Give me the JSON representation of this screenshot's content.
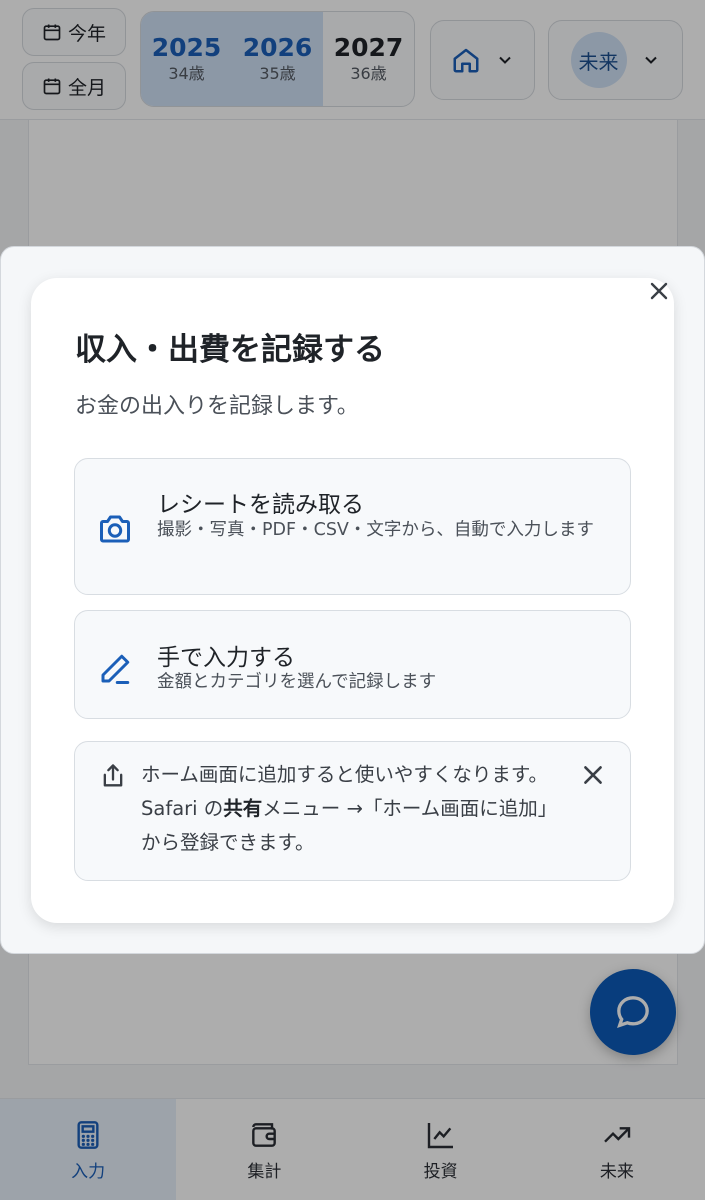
{
  "header": {
    "this_year_label": "今年",
    "full_month_label": "全月",
    "years": [
      {
        "year": "2025",
        "age": "34歳",
        "selected": true
      },
      {
        "year": "2026",
        "age": "35歳",
        "selected": true
      },
      {
        "year": "2027",
        "age": "36歳",
        "selected": false
      }
    ],
    "home_icon": "home-icon",
    "future_avatar_label": "未来"
  },
  "dialog": {
    "title": "収入・出費を記録する",
    "subtitle": "お金の出入りを記録します。",
    "options": [
      {
        "icon": "camera-icon",
        "title": "レシートを読み取る",
        "description": "撮影・写真・PDF・CSV・文字から、自動で入力します"
      },
      {
        "icon": "pencil-icon",
        "title": "手で入力する",
        "description": "金額とカテゴリを選んで記録します"
      }
    ],
    "tip": {
      "icon": "share-icon",
      "text_before": "ホーム画面に追加すると使いやすくなります。Safari の",
      "text_bold": "共有",
      "text_after": "メニュー →「ホーム画面に追加」から登録できます。"
    }
  },
  "bottom_nav": [
    {
      "label": "入力",
      "icon": "calculator-icon",
      "active": true
    },
    {
      "label": "集計",
      "icon": "wallet-icon",
      "active": false
    },
    {
      "label": "投資",
      "icon": "chart-line-icon",
      "active": false
    },
    {
      "label": "未来",
      "icon": "trending-up-icon",
      "active": false
    }
  ],
  "colors": {
    "accent": "#1b5fb8",
    "fab": "#0c5bb8",
    "selected_year_bg": "#cfe0f5"
  }
}
